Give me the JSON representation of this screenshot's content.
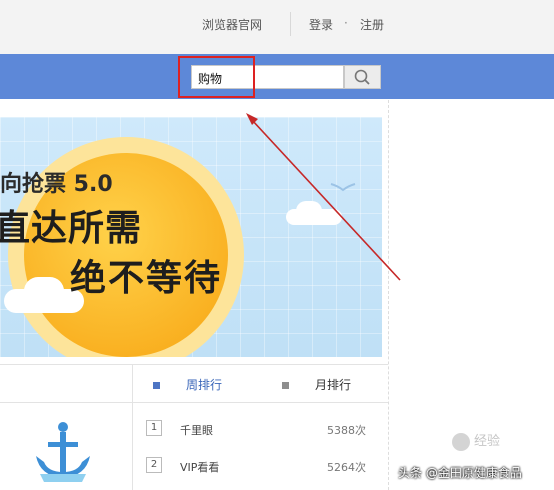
{
  "header": {
    "browser_link": "浏览器官网",
    "login": "登录",
    "separator_dot": "·",
    "register": "注册"
  },
  "search": {
    "value": "购物"
  },
  "banner": {
    "line1": "向抢票 5.0",
    "line2": "直达所需",
    "line3": "绝不等待"
  },
  "ranking": {
    "tabs": [
      {
        "label": "周排行"
      },
      {
        "label": "月排行"
      }
    ],
    "items": [
      {
        "rank": "1",
        "name": "千里眼",
        "count": "5388次"
      },
      {
        "rank": "2",
        "name": "VIP看看",
        "count": "5264次"
      }
    ]
  },
  "watermarks": {
    "site": "经验",
    "author": "头条 @金田原健康食品"
  },
  "colors": {
    "nav_blue": "#5d88d8",
    "highlight_red": "#d22",
    "banner_sky": "#cfe9fb",
    "sun_orange": "#f7a412"
  }
}
